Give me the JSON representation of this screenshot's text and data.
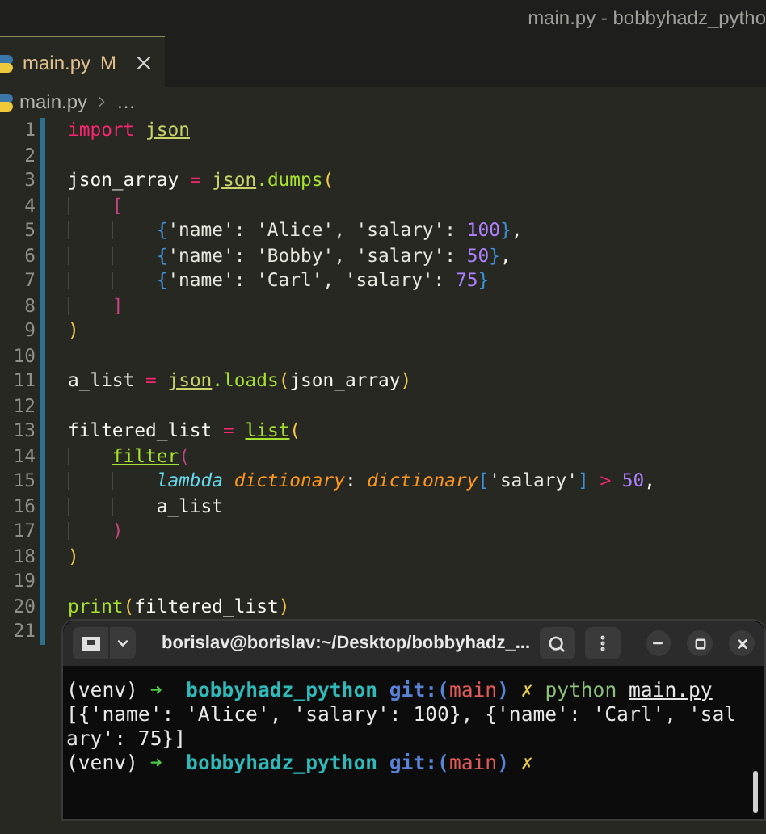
{
  "title_bar": {
    "title": "main.py - bobbyhadz_pytho"
  },
  "tabs": [
    {
      "label": "main.py",
      "badge": "M",
      "selected": true
    }
  ],
  "breadcrumb": {
    "file": "main.py",
    "rest": "…"
  },
  "editor": {
    "lines": [
      {
        "number": "1",
        "tokens": [
          {
            "text": "import ",
            "kind": "keyword"
          },
          {
            "text": "json",
            "kind": "module"
          }
        ]
      },
      {
        "number": "2"
      },
      {
        "number": "3",
        "tokens": [
          {
            "text": "json_array ",
            "kind": "plain"
          },
          {
            "text": "= ",
            "kind": "operator"
          },
          {
            "text": "json",
            "kind": "module"
          },
          {
            "text": ".dumps",
            "kind": "func"
          },
          {
            "text": "(",
            "kind": "bracket1"
          }
        ]
      },
      {
        "number": "4",
        "tokens": [
          {
            "text": "    [",
            "kind": "bracket2"
          }
        ]
      },
      {
        "number": "5",
        "tokens": [
          {
            "text": "        {",
            "kind": "bracket3"
          },
          {
            "text": "'name': 'Alice', 'salary': ",
            "kind": "string"
          },
          {
            "text": "100",
            "kind": "number"
          },
          {
            "text": "}",
            "kind": "bracket3"
          },
          {
            "text": ",",
            "kind": "plain"
          }
        ]
      },
      {
        "number": "6",
        "tokens": [
          {
            "text": "        {",
            "kind": "bracket3"
          },
          {
            "text": "'name': 'Bobby', 'salary': ",
            "kind": "string"
          },
          {
            "text": "50",
            "kind": "number"
          },
          {
            "text": "}",
            "kind": "bracket3"
          },
          {
            "text": ",",
            "kind": "plain"
          }
        ]
      },
      {
        "number": "7",
        "tokens": [
          {
            "text": "        {",
            "kind": "bracket3"
          },
          {
            "text": "'name': 'Carl', 'salary': ",
            "kind": "string"
          },
          {
            "text": "75",
            "kind": "number"
          },
          {
            "text": "}",
            "kind": "bracket3"
          }
        ]
      },
      {
        "number": "8",
        "tokens": [
          {
            "text": "    ]",
            "kind": "bracket2"
          }
        ]
      },
      {
        "number": "9",
        "tokens": [
          {
            "text": ")",
            "kind": "bracket1"
          }
        ]
      },
      {
        "number": "10"
      },
      {
        "number": "11",
        "tokens": [
          {
            "text": "a_list ",
            "kind": "plain"
          },
          {
            "text": "= ",
            "kind": "operator"
          },
          {
            "text": "json",
            "kind": "module"
          },
          {
            "text": ".loads",
            "kind": "func"
          },
          {
            "text": "(",
            "kind": "bracket1"
          },
          {
            "text": "json_array",
            "kind": "plain"
          },
          {
            "text": ")",
            "kind": "bracket1"
          }
        ]
      },
      {
        "number": "12"
      },
      {
        "number": "13",
        "tokens": [
          {
            "text": "filtered_list ",
            "kind": "plain"
          },
          {
            "text": "= ",
            "kind": "operator"
          },
          {
            "text": "list",
            "kind": "builtin"
          },
          {
            "text": "(",
            "kind": "bracket1"
          }
        ]
      },
      {
        "number": "14",
        "tokens": [
          {
            "text": "    filter",
            "kind": "builtin"
          },
          {
            "text": "(",
            "kind": "bracket2"
          }
        ]
      },
      {
        "number": "15",
        "tokens": [
          {
            "text": "        lambda ",
            "kind": "storage"
          },
          {
            "text": "dictionary",
            "kind": "param"
          },
          {
            "text": ": ",
            "kind": "plain"
          },
          {
            "text": "dictionary",
            "kind": "param"
          },
          {
            "text": "[",
            "kind": "bracket3"
          },
          {
            "text": "'salary'",
            "kind": "string"
          },
          {
            "text": "] ",
            "kind": "bracket3"
          },
          {
            "text": "> ",
            "kind": "operator"
          },
          {
            "text": "50",
            "kind": "number"
          },
          {
            "text": ",",
            "kind": "plain"
          }
        ]
      },
      {
        "number": "16",
        "tokens": [
          {
            "text": "        a_list",
            "kind": "plain"
          }
        ]
      },
      {
        "number": "17",
        "tokens": [
          {
            "text": "    )",
            "kind": "bracket2"
          }
        ]
      },
      {
        "number": "18",
        "tokens": [
          {
            "text": ")",
            "kind": "bracket1"
          }
        ]
      },
      {
        "number": "19"
      },
      {
        "number": "20",
        "tokens": [
          {
            "text": "print",
            "kind": "func"
          },
          {
            "text": "(",
            "kind": "bracket1"
          },
          {
            "text": "filtered_list",
            "kind": "plain"
          },
          {
            "text": ")",
            "kind": "bracket1"
          }
        ]
      },
      {
        "number": "21"
      }
    ]
  },
  "terminal": {
    "title": "borislav@borislav:~/Desktop/bobbyhadz_...",
    "lines": [
      {
        "tokens": [
          {
            "text": "(venv) ",
            "kind": "plain"
          },
          {
            "text": "➜  ",
            "kind": "arrow"
          },
          {
            "text": "bobbyhadz_python ",
            "kind": "dir"
          },
          {
            "text": "git:(",
            "kind": "git"
          },
          {
            "text": "main",
            "kind": "branch"
          },
          {
            "text": ") ",
            "kind": "git"
          },
          {
            "text": "✗ ",
            "kind": "cross"
          },
          {
            "text": "python ",
            "kind": "command"
          },
          {
            "text": "main.py",
            "kind": "arg"
          }
        ]
      },
      {
        "tokens": [
          {
            "text": "[{'name': 'Alice', 'salary': 100}, {'name': 'Carl', 'sal",
            "kind": "plain"
          }
        ]
      },
      {
        "tokens": [
          {
            "text": "ary': 75}]",
            "kind": "plain"
          }
        ]
      },
      {
        "tokens": [
          {
            "text": "(venv) ",
            "kind": "plain"
          },
          {
            "text": "➜  ",
            "kind": "arrow"
          },
          {
            "text": "bobbyhadz_python ",
            "kind": "dir"
          },
          {
            "text": "git:(",
            "kind": "git"
          },
          {
            "text": "main",
            "kind": "branch"
          },
          {
            "text": ") ",
            "kind": "git"
          },
          {
            "text": "✗",
            "kind": "cross"
          }
        ]
      }
    ]
  }
}
